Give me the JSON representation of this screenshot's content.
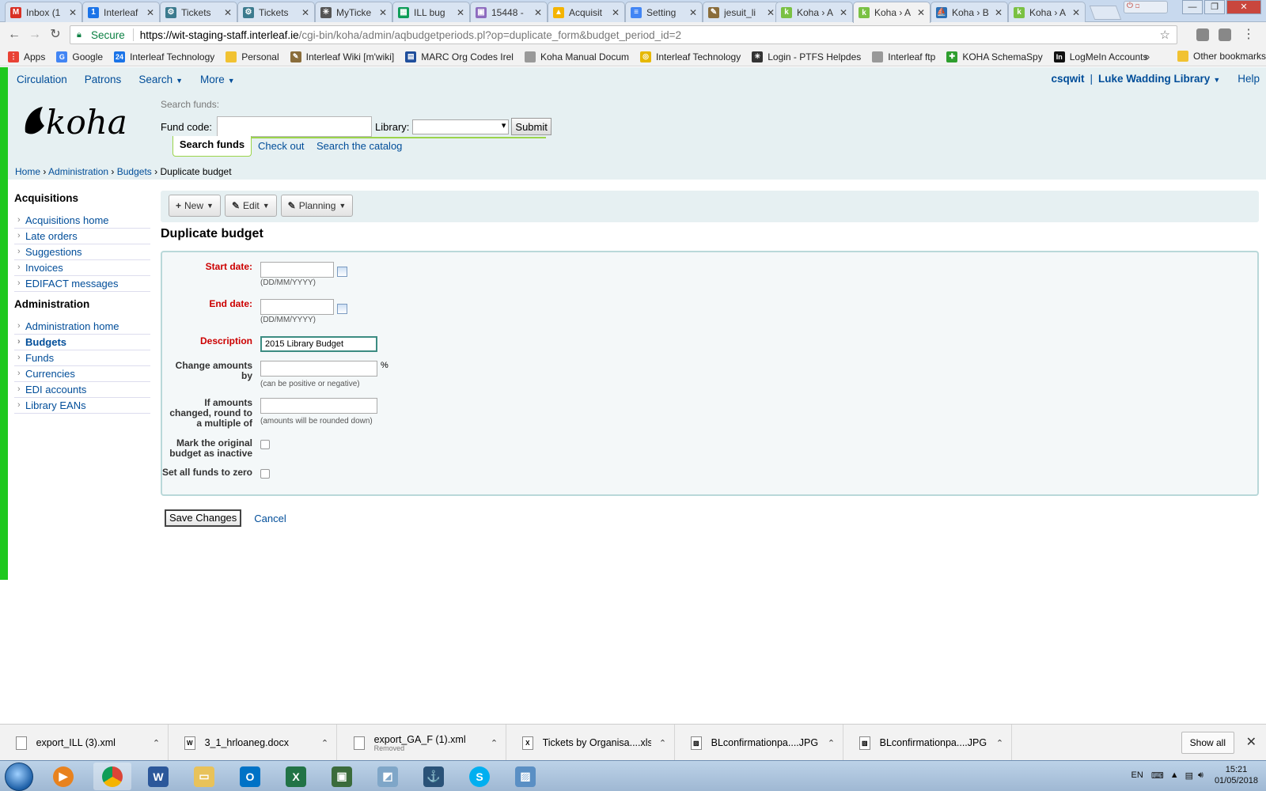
{
  "browser": {
    "tabs": [
      {
        "label": "Inbox (1",
        "icon": "gmail-icon",
        "color": "#d93025",
        "glyph": "M"
      },
      {
        "label": "Interleaf",
        "icon": "calendar-icon",
        "color": "#1a73e8",
        "glyph": "1"
      },
      {
        "label": "Tickets",
        "icon": "ticket-icon",
        "color": "#3c7b8e",
        "glyph": "⚙"
      },
      {
        "label": "Tickets",
        "icon": "ticket-icon",
        "color": "#3c7b8e",
        "glyph": "⚙"
      },
      {
        "label": "MyTicke",
        "icon": "asterisk-icon",
        "color": "#555555",
        "glyph": "✳"
      },
      {
        "label": "ILL bug",
        "icon": "sheets-icon",
        "color": "#0f9d58",
        "glyph": "▦"
      },
      {
        "label": "15448 -",
        "icon": "image-icon",
        "color": "#8e6cbf",
        "glyph": "▣"
      },
      {
        "label": "Acquisit",
        "icon": "drive-icon",
        "color": "#f4b400",
        "glyph": "▲"
      },
      {
        "label": "Setting",
        "icon": "docs-icon",
        "color": "#4285f4",
        "glyph": "≡"
      },
      {
        "label": "jesuit_li",
        "icon": "git-icon",
        "color": "#8a6d3b",
        "glyph": "✎"
      },
      {
        "label": "Koha › A",
        "icon": "koha-icon",
        "color": "#7ac143",
        "glyph": "k"
      },
      {
        "label": "Koha › A",
        "icon": "koha-icon",
        "color": "#7ac143",
        "glyph": "k",
        "active": true
      },
      {
        "label": "Koha › B",
        "icon": "sailing-icon",
        "color": "#2a6fb5",
        "glyph": "⛵"
      },
      {
        "label": "Koha › A",
        "icon": "koha-icon",
        "color": "#7ac143",
        "glyph": "k"
      }
    ],
    "url_secure_label": "Secure",
    "url_host": "https://wit-staging-staff.interleaf.ie",
    "url_path": "/cgi-bin/koha/admin/aqbudgetperiods.pl?op=duplicate_form&budget_period_id=2",
    "bookmarks": [
      {
        "label": "Apps",
        "icon": "apps-icon",
        "color": "#e94235",
        "glyph": "⋮"
      },
      {
        "label": "Google",
        "icon": "google-icon",
        "color": "#4285f4",
        "glyph": "G"
      },
      {
        "label": "Interleaf Technology",
        "icon": "calendar-icon",
        "color": "#1a73e8",
        "glyph": "24"
      },
      {
        "label": "Personal",
        "icon": "folder-icon",
        "color": "#f1c232",
        "glyph": ""
      },
      {
        "label": "Interleaf Wiki [m'wiki]",
        "icon": "wiki-icon",
        "color": "#8a6d3b",
        "glyph": "✎"
      },
      {
        "label": "MARC Org Codes Irel",
        "icon": "flag-icon",
        "color": "#1f4e9c",
        "glyph": "▤"
      },
      {
        "label": "Koha Manual Docum",
        "icon": "page-icon",
        "color": "#999999",
        "glyph": ""
      },
      {
        "label": "Interleaf Technology",
        "icon": "ring-icon",
        "color": "#e6b800",
        "glyph": "◎"
      },
      {
        "label": "Login - PTFS Helpdes",
        "icon": "asterisk-icon",
        "color": "#333333",
        "glyph": "✳"
      },
      {
        "label": "Interleaf ftp",
        "icon": "page-icon",
        "color": "#999999",
        "glyph": ""
      },
      {
        "label": "KOHA SchemaSpy",
        "icon": "schema-icon",
        "color": "#2e9e2e",
        "glyph": "✚"
      },
      {
        "label": "LogMeIn Accounts",
        "icon": "logmein-icon",
        "color": "#111111",
        "glyph": "In"
      }
    ],
    "bookmarks_overflow": "»",
    "other_bookmarks": "Other bookmarks"
  },
  "koha": {
    "topnav": {
      "circulation": "Circulation",
      "patrons": "Patrons",
      "search": "Search",
      "more": "More",
      "user": "csqwit",
      "separator": "|",
      "library": "Luke Wadding Library",
      "help": "Help"
    },
    "header": {
      "logo_text": "koha",
      "search_label": "Search funds:",
      "fund_code_label": "Fund code:",
      "library_label": "Library:",
      "library_value": "",
      "submit_label": "Submit",
      "tabs": {
        "search_funds": "Search funds",
        "check_out": "Check out",
        "search_catalog": "Search the catalog"
      }
    },
    "breadcrumb": {
      "home": "Home",
      "administration": "Administration",
      "budgets": "Budgets",
      "current": "Duplicate budget",
      "sep": "›"
    },
    "sidebar": {
      "acq_heading": "Acquisitions",
      "acq_items": [
        "Acquisitions home",
        "Late orders",
        "Suggestions",
        "Invoices",
        "EDIFACT messages"
      ],
      "admin_heading": "Administration",
      "admin_items": [
        "Administration home",
        "Budgets",
        "Funds",
        "Currencies",
        "EDI accounts",
        "Library EANs"
      ],
      "current": "Budgets"
    },
    "toolbar": {
      "new": "New",
      "edit": "Edit",
      "planning": "Planning"
    },
    "page_title": "Duplicate budget",
    "form": {
      "start_date_label": "Start date:",
      "start_date_value": "",
      "end_date_label": "End date:",
      "end_date_value": "",
      "date_hint": "(DD/MM/YYYY)",
      "description_label": "Description",
      "description_value": "2015 Library Budget",
      "change_amounts_label": "Change amounts by",
      "change_amounts_value": "",
      "percent": "%",
      "change_hint": "(can be positive or negative)",
      "round_label": "If amounts changed, round to a multiple of",
      "round_value": "",
      "round_hint": "(amounts will be rounded down)",
      "mark_inactive_label": "Mark the original budget as inactive",
      "mark_inactive_checked": false,
      "zero_funds_label": "Set all funds to zero",
      "zero_funds_checked": false
    },
    "save_label": "Save Changes",
    "cancel_label": "Cancel",
    "colors": {
      "accent_green": "#1ec81e",
      "link": "#004d99",
      "required": "#cc0000",
      "header_bg": "#e6f0f2"
    }
  },
  "downloads": {
    "items": [
      {
        "name": "export_ILL (3).xml",
        "sub": "",
        "type": "file-icon"
      },
      {
        "name": "3_1_hrloaneg.docx",
        "sub": "",
        "type": "word-doc-icon"
      },
      {
        "name": "export_GA_F (1).xml",
        "sub": "Removed",
        "type": "file-icon"
      },
      {
        "name": "Tickets by Organisa....xls",
        "sub": "",
        "type": "excel-doc-icon"
      },
      {
        "name": "BLconfirmationpa....JPG",
        "sub": "",
        "type": "image-file-icon"
      },
      {
        "name": "BLconfirmationpa....JPG",
        "sub": "",
        "type": "image-file-icon"
      }
    ],
    "show_all": "Show all"
  },
  "taskbar": {
    "lang": "EN",
    "time": "15:21",
    "date": "01/05/2018"
  }
}
